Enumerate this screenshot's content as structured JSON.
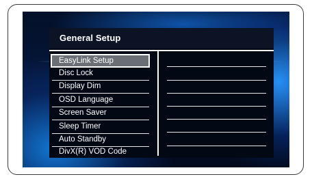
{
  "menu": {
    "title": "General Setup",
    "items": [
      {
        "label": "EasyLink Setup",
        "selected": true
      },
      {
        "label": "Disc Lock",
        "selected": false
      },
      {
        "label": "Display Dim",
        "selected": false
      },
      {
        "label": "OSD Language",
        "selected": false
      },
      {
        "label": "Screen Saver",
        "selected": false
      },
      {
        "label": "Sleep Timer",
        "selected": false
      },
      {
        "label": "Auto Standby",
        "selected": false
      },
      {
        "label": "DivX(R) VOD Code",
        "selected": false
      }
    ]
  },
  "colors": {
    "selection": "#6a6f76",
    "panel": "#020814",
    "accent_blue": "#1e8ef0"
  }
}
